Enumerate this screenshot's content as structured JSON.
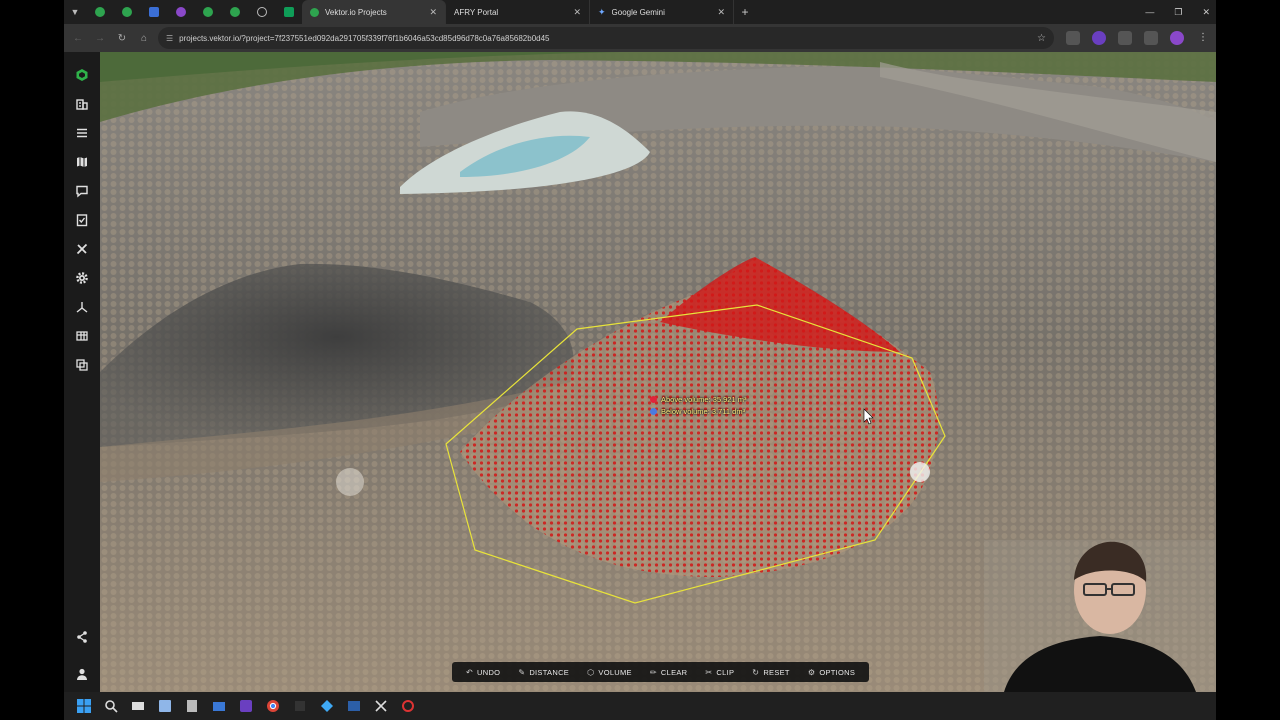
{
  "browser": {
    "tabs": [
      {
        "title": "Vektor.io Projects",
        "active": true
      },
      {
        "title": "AFRY Portal",
        "active": false
      },
      {
        "title": "Google Gemini",
        "active": false
      }
    ],
    "url": "projects.vektor.io/?project=7f237551ed092da291705f339f76f1b6046a53cd85d96d78c0a76a85682b0d45"
  },
  "viewport": {
    "measurements": {
      "above": "Above volume: 35.921 m³",
      "below": "Below volume: 3.711 dm³"
    },
    "colors": {
      "above_dot": "#e0243a",
      "below_dot": "#4a7be0",
      "polygon": "#e8e33a",
      "cloud_red": "#d21616"
    }
  },
  "toolbar": {
    "undo": "UNDO",
    "distance": "DISTANCE",
    "volume": "VOLUME",
    "clear": "CLEAR",
    "clip": "CLIP",
    "reset": "RESET",
    "options": "OPTIONS"
  },
  "sidebar": {
    "icons": [
      "vektor-logo-icon",
      "buildings-icon",
      "list-icon",
      "map-icon",
      "comment-icon",
      "checklist-icon",
      "tools-icon",
      "gear-icon",
      "axis-icon",
      "table-icon",
      "layers-icon"
    ],
    "bottom_icons": [
      "share-icon",
      "user-icon"
    ]
  }
}
